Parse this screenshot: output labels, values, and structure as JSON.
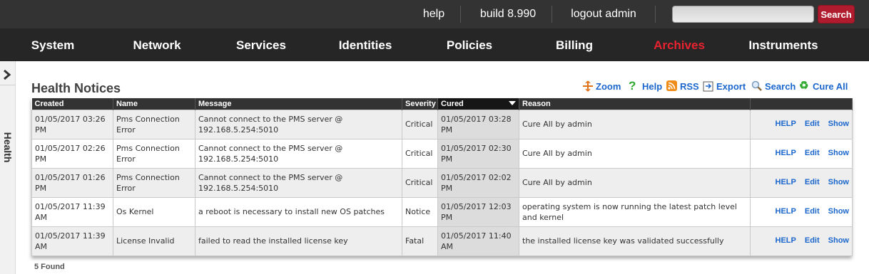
{
  "topbar": {
    "help": "help",
    "build": "build 8.990",
    "logout": "logout admin",
    "search_placeholder": "",
    "search_button": "Search",
    "accent": "#b01c2e"
  },
  "nav": {
    "items": [
      {
        "label": "System"
      },
      {
        "label": "Network"
      },
      {
        "label": "Services"
      },
      {
        "label": "Identities"
      },
      {
        "label": "Policies"
      },
      {
        "label": "Billing"
      },
      {
        "label": "Archives",
        "active": true
      },
      {
        "label": "Instruments"
      }
    ],
    "active_color": "#e8232f"
  },
  "sidebar": {
    "label": "Health",
    "icon": "chevron-right-icon"
  },
  "page": {
    "title": "Health Notices",
    "found": "5 Found"
  },
  "toolbar": {
    "zoom": "Zoom",
    "help": "Help",
    "rss": "RSS",
    "export": "Export",
    "search": "Search",
    "cure_all": "Cure All"
  },
  "table": {
    "columns": [
      "Created",
      "Name",
      "Message",
      "Severity",
      "Cured",
      "Reason",
      ""
    ],
    "sorted_column": "Cured",
    "rows": [
      {
        "created": "01/05/2017 03:26 PM",
        "name": "Pms Connection Error",
        "message": "Cannot connect to the PMS server @ 192.168.5.254:5010",
        "severity": "Critical",
        "cured": "01/05/2017 03:28 PM",
        "reason": "Cure All by admin"
      },
      {
        "created": "01/05/2017 02:26 PM",
        "name": "Pms Connection Error",
        "message": "Cannot connect to the PMS server @ 192.168.5.254:5010",
        "severity": "Critical",
        "cured": "01/05/2017 02:30 PM",
        "reason": "Cure All by admin"
      },
      {
        "created": "01/05/2017 01:26 PM",
        "name": "Pms Connection Error",
        "message": "Cannot connect to the PMS server @ 192.168.5.254:5010",
        "severity": "Critical",
        "cured": "01/05/2017 02:02 PM",
        "reason": "Cure All by admin"
      },
      {
        "created": "01/05/2017 11:39 AM",
        "name": "Os Kernel",
        "message": "a reboot is necessary to install new OS patches",
        "severity": "Notice",
        "cured": "01/05/2017 12:03 PM",
        "reason": "operating system is now running the latest patch level and kernel"
      },
      {
        "created": "01/05/2017 11:39 AM",
        "name": "License Invalid",
        "message": "failed to read the installed license key",
        "severity": "Fatal",
        "cured": "01/05/2017 11:40 AM",
        "reason": "the installed license key was validated successfully"
      }
    ],
    "row_actions": {
      "help": "HELP",
      "edit": "Edit",
      "show": "Show"
    }
  }
}
